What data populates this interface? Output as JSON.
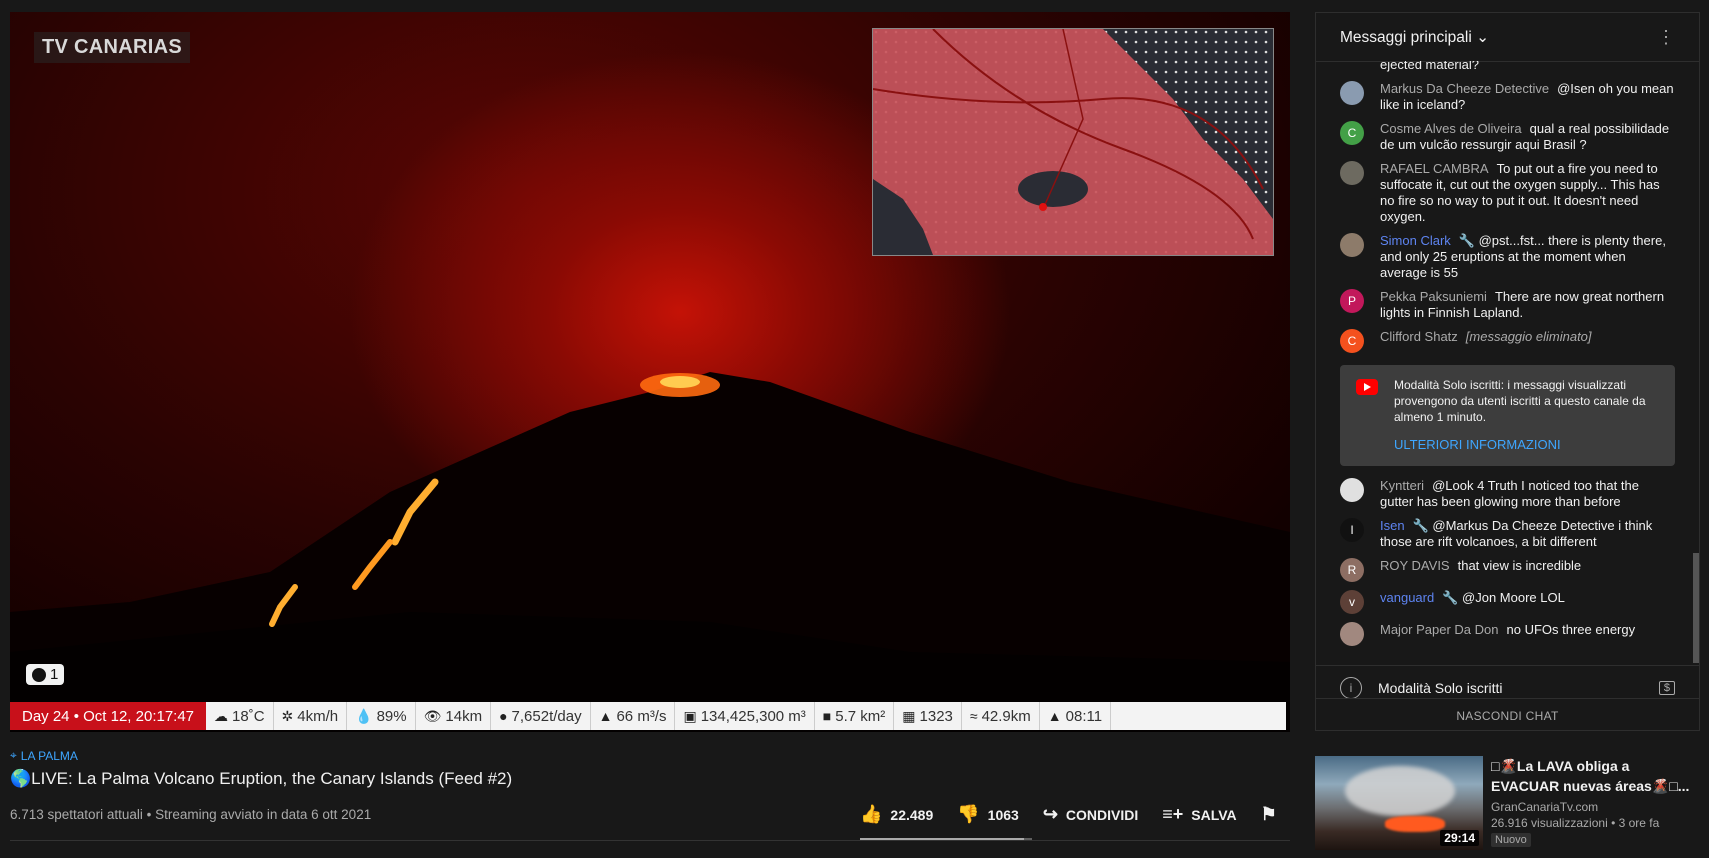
{
  "video": {
    "watermark": "TV CANARIAS",
    "camera_count": "1",
    "stats": {
      "date": "Day 24 • Oct 12, 20:17:47",
      "temp": "18˚C",
      "wind": "4km/h",
      "humidity": "89%",
      "visibility": "14km",
      "so2": "7,652t/day",
      "flow": "66 m³/s",
      "volume": "134,425,300 m³",
      "area": "5.7 km²",
      "buildings": "1323",
      "roads": "42.9km",
      "time": "08:11"
    }
  },
  "meta": {
    "location": "LA PALMA",
    "title": "🌎LIVE: La Palma Volcano Eruption, the Canary Islands (Feed #2)",
    "views": "6.713 spettatori attuali • Streaming avviato in data 6 ott 2021",
    "likes": "22.489",
    "dislikes": "1063",
    "like_ratio": 0.955,
    "share": "CONDIVIDI",
    "save": "SALVA"
  },
  "chat": {
    "header": "Messaggi principali",
    "partial": "ejected material?",
    "messages": [
      {
        "author": "Markus Da Cheeze Detective",
        "text": "@Isen oh you mean like in iceland?",
        "avatar": "",
        "color": "#8a9bb0"
      },
      {
        "author": "Cosme Alves de Oliveira",
        "text": "qual a real possibilidade de um vulcão ressurgir aqui Brasil ?",
        "avatar": "C",
        "color": "#43a047"
      },
      {
        "author": "RAFAEL CAMBRA",
        "text": "To put out a fire you need to suffocate it, cut out the oxygen supply... This has no fire so no way to put it out. It doesn't need oxygen.",
        "avatar": "",
        "color": "#6d6a60"
      },
      {
        "author": "Simon Clark",
        "text": "@pst...fst... there is plenty there, and only 25 eruptions at the moment when average is 55",
        "avatar": "",
        "color": "#8d7b6a",
        "mod": true
      },
      {
        "author": "Pekka Paksuniemi",
        "text": "There are now great northern lights in Finnish Lapland.",
        "avatar": "P",
        "color": "#c2185b"
      },
      {
        "author": "Clifford Shatz",
        "text": "[messaggio eliminato]",
        "avatar": "C",
        "color": "#f4511e",
        "deleted": true
      }
    ],
    "notice": {
      "text": "Modalità Solo iscritti: i messaggi visualizzati provengono da utenti iscritti a questo canale da almeno 1 minuto.",
      "link": "ULTERIORI INFORMAZIONI"
    },
    "messages2": [
      {
        "author": "Kyntteri",
        "text": "@Look 4 Truth I noticed too that the gutter has been glowing more than before",
        "avatar": "",
        "color": "#e0e0e0"
      },
      {
        "author": "Isen",
        "text": "@Markus Da Cheeze Detective i think those are rift volcanoes, a bit different",
        "avatar": "I",
        "color": "#111111",
        "mod": true
      },
      {
        "author": "ROY DAVIS",
        "text": "that view is incredible",
        "avatar": "R",
        "color": "#8d6e63"
      },
      {
        "author": "vanguard",
        "text": "@Jon Moore LOL",
        "avatar": "v",
        "color": "#5d4037",
        "mod": true
      },
      {
        "author": "Major Paper Da Don",
        "text": "no UFOs three energy",
        "avatar": "",
        "color": "#a1887f"
      }
    ],
    "footer": "Modalità Solo iscritti",
    "hide": "NASCONDI CHAT"
  },
  "recommendation": {
    "title": "□🌋La LAVA obliga a EVACUAR nuevas áreas🌋□...",
    "channel": "GranCanariaTv.com",
    "views": "26.916 visualizzazioni • 3 ore fa",
    "badge": "Nuovo",
    "duration": "29:14"
  }
}
